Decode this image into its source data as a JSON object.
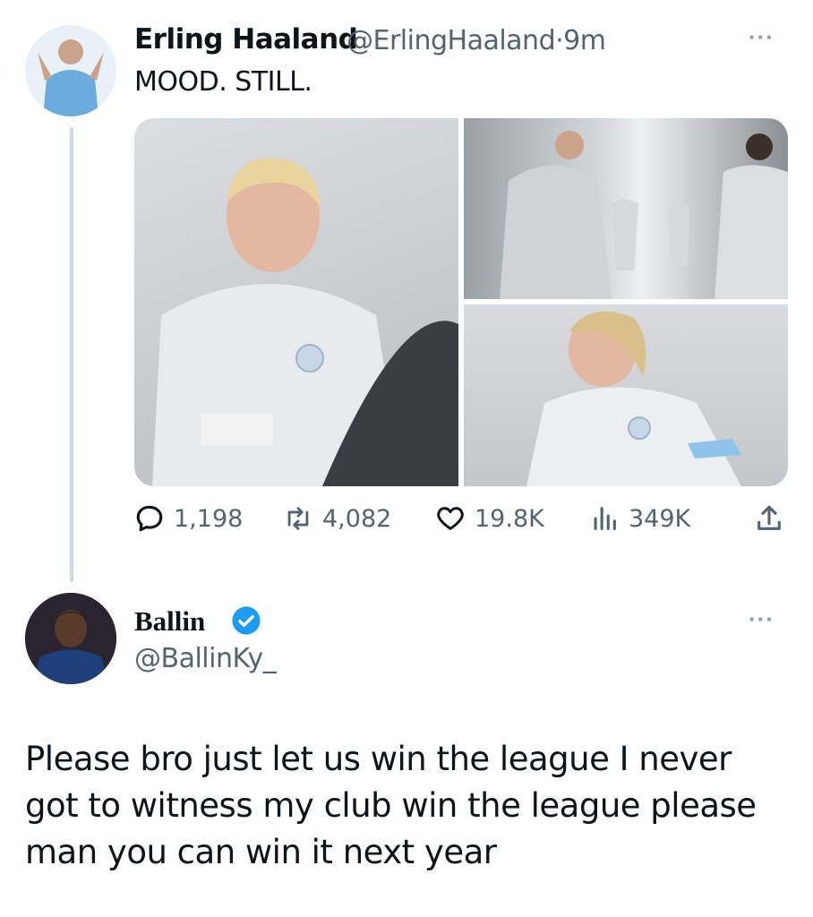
{
  "tweet1": {
    "author_name": "Erling Haaland",
    "handle_time": "@ErlingHaaland·9m",
    "text": "MOOD. STILL.",
    "more": "···",
    "stats": {
      "replies": "1,198",
      "retweets": "4,082",
      "likes": "19.8K",
      "views": "349K"
    }
  },
  "tweet2": {
    "author_name": "Ballin",
    "handle": "@BallinKy_",
    "more": "···",
    "text": "Please bro just let us win the league I never got to witness my club win the league please man you can win it next year"
  },
  "colors": {
    "text_primary": "#0f1419",
    "text_secondary": "#536471",
    "verified_blue": "#1d9bf0",
    "thread_line": "#cfd9de"
  }
}
